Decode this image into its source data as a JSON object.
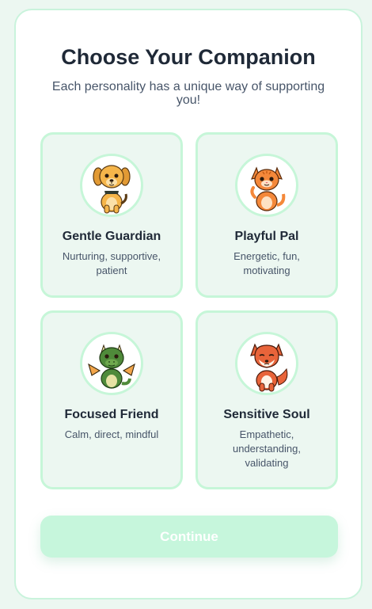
{
  "header": {
    "title": "Choose Your Companion",
    "subtitle": "Each personality has a unique way of supporting you!"
  },
  "companions": [
    {
      "name": "Gentle Guardian",
      "description": "Nurturing, supportive, patient",
      "icon": "puppy-icon"
    },
    {
      "name": "Playful Pal",
      "description": "Energetic, fun, motivating",
      "icon": "kitten-icon"
    },
    {
      "name": "Focused Friend",
      "description": "Calm, direct, mindful",
      "icon": "dragon-icon"
    },
    {
      "name": "Sensitive Soul",
      "description": "Empathetic, understanding, validating",
      "icon": "fox-icon"
    }
  ],
  "actions": {
    "continue_label": "Continue"
  },
  "colors": {
    "accent": "#c6f6d8",
    "background": "#ecf7f1",
    "title_text": "#1f2937",
    "body_text": "#475569",
    "button_disabled": "#c6f6dc"
  }
}
